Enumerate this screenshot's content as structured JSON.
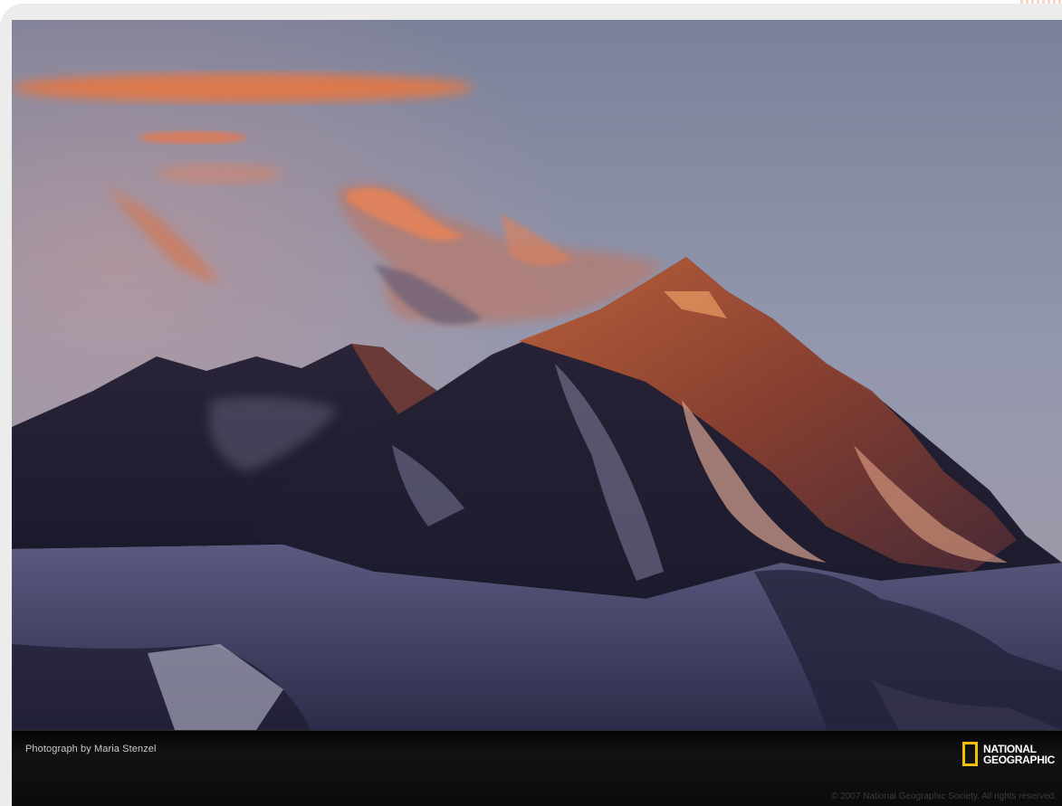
{
  "photo": {
    "caption": "Photograph by Maria Stenzel"
  },
  "brand": {
    "logo_line1": "NATIONAL",
    "logo_line2": "GEOGRAPHIC",
    "logo_color": "#f2c200"
  },
  "footer": {
    "copyright": "© 2007 National Geographic Society. All rights reserved."
  },
  "colors": {
    "sky": "#8f95ad",
    "alpenglow": "#e0784a",
    "bar": "#0a0a0a"
  }
}
